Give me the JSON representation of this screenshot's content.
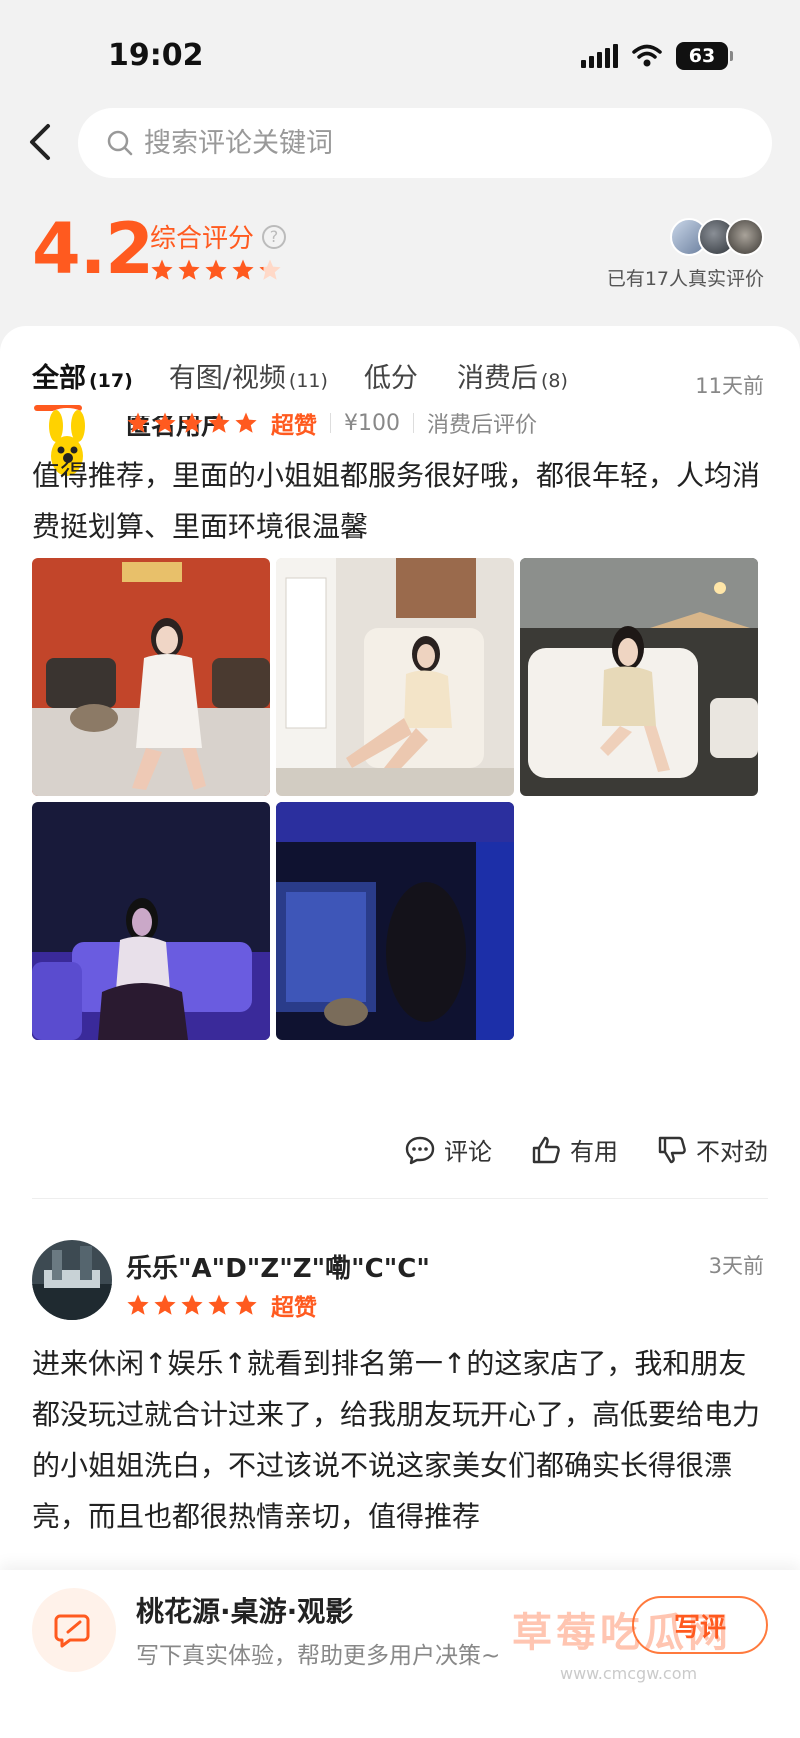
{
  "status_bar": {
    "time": "19:02",
    "battery": "63"
  },
  "search": {
    "placeholder": "搜索评论关键词"
  },
  "summary": {
    "score": "4.2",
    "score_label": "综合评分",
    "help_icon": "?",
    "rating": 4.2,
    "review_count_text": "已有17人真实评价"
  },
  "tabs": [
    {
      "label": "全部",
      "count": "(17)"
    },
    {
      "label": "有图/视频",
      "count": "(11)"
    },
    {
      "label": "低分",
      "count": ""
    },
    {
      "label": "消费后",
      "count": "(8)"
    }
  ],
  "reviews": [
    {
      "name": "匿名用户",
      "time": "11天前",
      "stars": 5,
      "level": "超赞",
      "price": "¥100",
      "tag": "消费后评价",
      "text": "值得推荐，里面的小姐姐都服务很好哦，都很年轻，人均消费挺划算、里面环境很温馨",
      "photo_count": 5
    },
    {
      "name": "乐乐\"A\"D\"Z\"Z\"嘞\"C\"C\"",
      "time": "3天前",
      "stars": 5,
      "level": "超赞",
      "text": "进来休闲↑娱乐↑就看到排名第一↑的这家店了，我和朋友都没玩过就合计过来了，给我朋友玩开心了，高低要给电力的小姐姐洗白，不过该说不说这家美女们都确实长得很漂亮，而且也都很热情亲切，值得推荐"
    }
  ],
  "actions": {
    "comment": "评论",
    "useful": "有用",
    "wrong": "不对劲"
  },
  "bottom_bar": {
    "shop_name": "桃花源·桌游·观影",
    "shop_sub": "写下真实体验，帮助更多用户决策~",
    "write_label": "写评",
    "watermark": "草莓吃瓜网",
    "watermark_sub": "www.cmcgw.com"
  },
  "colors": {
    "accent": "#ff5a1f",
    "background": "#f2f2f2"
  },
  "icons": [
    "back-arrow-icon",
    "search-icon",
    "help-icon",
    "star-icon",
    "comment-icon",
    "thumbs-up-icon",
    "thumbs-down-icon",
    "edit-icon"
  ]
}
